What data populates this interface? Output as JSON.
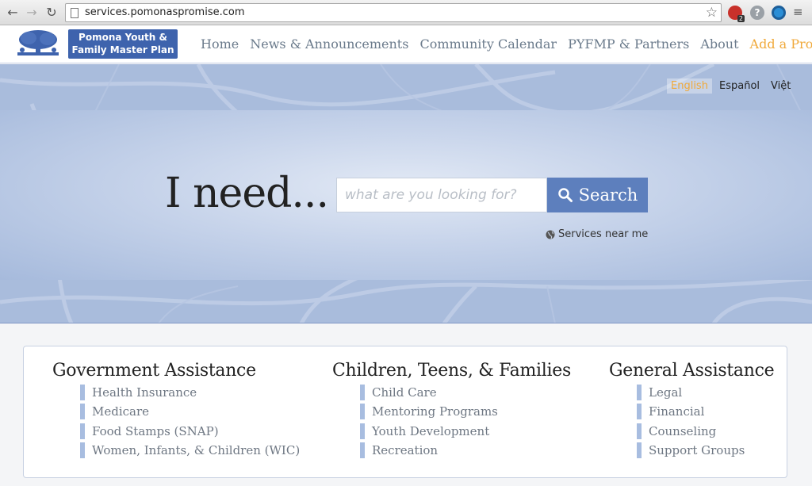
{
  "browser": {
    "url": "services.pomonaspromise.com",
    "extension_badge": "2",
    "help_glyph": "?",
    "icons": [
      "back-arrow-icon",
      "forward-arrow-icon",
      "reload-icon",
      "page-icon",
      "bookmark-star-icon",
      "menu-icon"
    ]
  },
  "header": {
    "logo_line1": "Pomona Youth &",
    "logo_line2": "Family Master Plan",
    "nav": [
      {
        "label": "Home"
      },
      {
        "label": "News & Announcements"
      },
      {
        "label": "Community Calendar"
      },
      {
        "label": "PYFMP & Partners"
      },
      {
        "label": "About"
      },
      {
        "label": "Add a Program"
      }
    ]
  },
  "languages": [
    {
      "label": "English",
      "active": true
    },
    {
      "label": "Español"
    },
    {
      "label": "Việt"
    }
  ],
  "hero": {
    "headline": "I need...",
    "search_placeholder": "what are you looking for?",
    "search_button": "Search",
    "near_me": "Services near me"
  },
  "categories": [
    {
      "title": "Government Assistance",
      "items": [
        "Health Insurance",
        "Medicare",
        "Food Stamps (SNAP)",
        "Women, Infants, & Children (WIC)"
      ]
    },
    {
      "title": "Children, Teens, & Families",
      "items": [
        "Child Care",
        "Mentoring Programs",
        "Youth Development",
        "Recreation"
      ]
    },
    {
      "title": "General Assistance",
      "items": [
        "Legal",
        "Financial",
        "Counseling",
        "Support Groups"
      ]
    }
  ],
  "colors": {
    "accent": "#f0a93a",
    "brand_blue": "#3e63ad",
    "search_button": "#5d7fbd",
    "hero": "#a9bcdc"
  }
}
